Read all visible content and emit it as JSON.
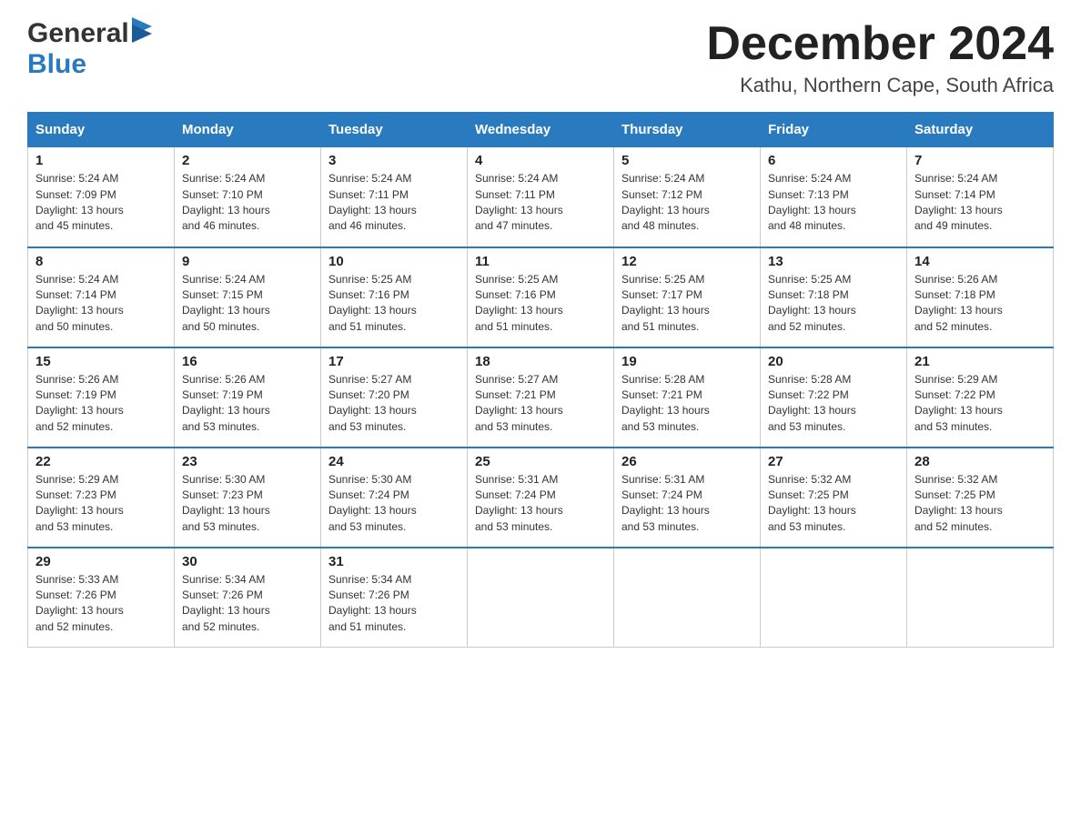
{
  "header": {
    "logo_general": "General",
    "logo_blue": "Blue",
    "month_title": "December 2024",
    "location": "Kathu, Northern Cape, South Africa"
  },
  "days_of_week": [
    "Sunday",
    "Monday",
    "Tuesday",
    "Wednesday",
    "Thursday",
    "Friday",
    "Saturday"
  ],
  "weeks": [
    [
      {
        "day": "1",
        "sunrise": "5:24 AM",
        "sunset": "7:09 PM",
        "daylight": "13 hours and 45 minutes."
      },
      {
        "day": "2",
        "sunrise": "5:24 AM",
        "sunset": "7:10 PM",
        "daylight": "13 hours and 46 minutes."
      },
      {
        "day": "3",
        "sunrise": "5:24 AM",
        "sunset": "7:11 PM",
        "daylight": "13 hours and 46 minutes."
      },
      {
        "day": "4",
        "sunrise": "5:24 AM",
        "sunset": "7:11 PM",
        "daylight": "13 hours and 47 minutes."
      },
      {
        "day": "5",
        "sunrise": "5:24 AM",
        "sunset": "7:12 PM",
        "daylight": "13 hours and 48 minutes."
      },
      {
        "day": "6",
        "sunrise": "5:24 AM",
        "sunset": "7:13 PM",
        "daylight": "13 hours and 48 minutes."
      },
      {
        "day": "7",
        "sunrise": "5:24 AM",
        "sunset": "7:14 PM",
        "daylight": "13 hours and 49 minutes."
      }
    ],
    [
      {
        "day": "8",
        "sunrise": "5:24 AM",
        "sunset": "7:14 PM",
        "daylight": "13 hours and 50 minutes."
      },
      {
        "day": "9",
        "sunrise": "5:24 AM",
        "sunset": "7:15 PM",
        "daylight": "13 hours and 50 minutes."
      },
      {
        "day": "10",
        "sunrise": "5:25 AM",
        "sunset": "7:16 PM",
        "daylight": "13 hours and 51 minutes."
      },
      {
        "day": "11",
        "sunrise": "5:25 AM",
        "sunset": "7:16 PM",
        "daylight": "13 hours and 51 minutes."
      },
      {
        "day": "12",
        "sunrise": "5:25 AM",
        "sunset": "7:17 PM",
        "daylight": "13 hours and 51 minutes."
      },
      {
        "day": "13",
        "sunrise": "5:25 AM",
        "sunset": "7:18 PM",
        "daylight": "13 hours and 52 minutes."
      },
      {
        "day": "14",
        "sunrise": "5:26 AM",
        "sunset": "7:18 PM",
        "daylight": "13 hours and 52 minutes."
      }
    ],
    [
      {
        "day": "15",
        "sunrise": "5:26 AM",
        "sunset": "7:19 PM",
        "daylight": "13 hours and 52 minutes."
      },
      {
        "day": "16",
        "sunrise": "5:26 AM",
        "sunset": "7:19 PM",
        "daylight": "13 hours and 53 minutes."
      },
      {
        "day": "17",
        "sunrise": "5:27 AM",
        "sunset": "7:20 PM",
        "daylight": "13 hours and 53 minutes."
      },
      {
        "day": "18",
        "sunrise": "5:27 AM",
        "sunset": "7:21 PM",
        "daylight": "13 hours and 53 minutes."
      },
      {
        "day": "19",
        "sunrise": "5:28 AM",
        "sunset": "7:21 PM",
        "daylight": "13 hours and 53 minutes."
      },
      {
        "day": "20",
        "sunrise": "5:28 AM",
        "sunset": "7:22 PM",
        "daylight": "13 hours and 53 minutes."
      },
      {
        "day": "21",
        "sunrise": "5:29 AM",
        "sunset": "7:22 PM",
        "daylight": "13 hours and 53 minutes."
      }
    ],
    [
      {
        "day": "22",
        "sunrise": "5:29 AM",
        "sunset": "7:23 PM",
        "daylight": "13 hours and 53 minutes."
      },
      {
        "day": "23",
        "sunrise": "5:30 AM",
        "sunset": "7:23 PM",
        "daylight": "13 hours and 53 minutes."
      },
      {
        "day": "24",
        "sunrise": "5:30 AM",
        "sunset": "7:24 PM",
        "daylight": "13 hours and 53 minutes."
      },
      {
        "day": "25",
        "sunrise": "5:31 AM",
        "sunset": "7:24 PM",
        "daylight": "13 hours and 53 minutes."
      },
      {
        "day": "26",
        "sunrise": "5:31 AM",
        "sunset": "7:24 PM",
        "daylight": "13 hours and 53 minutes."
      },
      {
        "day": "27",
        "sunrise": "5:32 AM",
        "sunset": "7:25 PM",
        "daylight": "13 hours and 53 minutes."
      },
      {
        "day": "28",
        "sunrise": "5:32 AM",
        "sunset": "7:25 PM",
        "daylight": "13 hours and 52 minutes."
      }
    ],
    [
      {
        "day": "29",
        "sunrise": "5:33 AM",
        "sunset": "7:26 PM",
        "daylight": "13 hours and 52 minutes."
      },
      {
        "day": "30",
        "sunrise": "5:34 AM",
        "sunset": "7:26 PM",
        "daylight": "13 hours and 52 minutes."
      },
      {
        "day": "31",
        "sunrise": "5:34 AM",
        "sunset": "7:26 PM",
        "daylight": "13 hours and 51 minutes."
      },
      null,
      null,
      null,
      null
    ]
  ],
  "labels": {
    "sunrise": "Sunrise:",
    "sunset": "Sunset:",
    "daylight": "Daylight:"
  }
}
